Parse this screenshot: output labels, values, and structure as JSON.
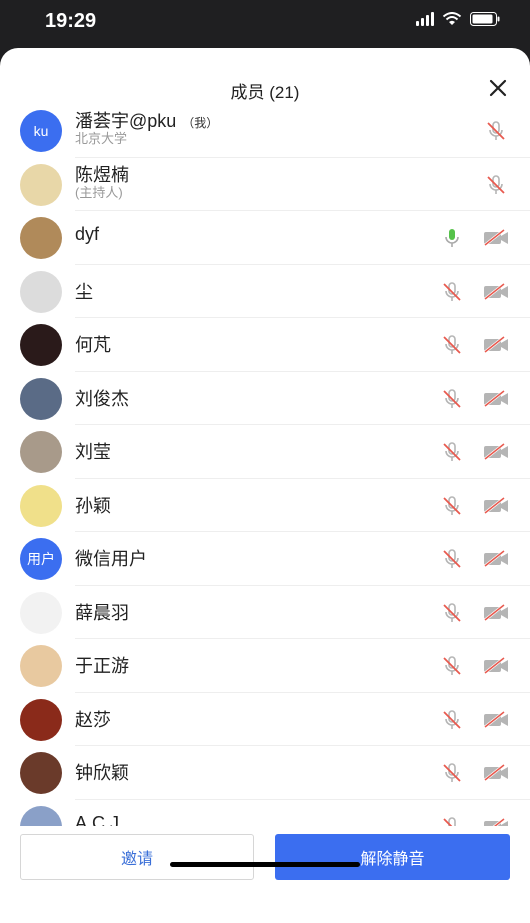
{
  "status": {
    "time": "19:29"
  },
  "header": {
    "title": "成员 (21)"
  },
  "members": [
    {
      "name": "潘荟宇@pku",
      "tag": "（我）",
      "sub": "北京大学",
      "avatar_text": "ku",
      "avatar_color": "#3b6ef0",
      "mic": "muted",
      "cam": null
    },
    {
      "name": "陈煜楠",
      "tag": "",
      "sub": "(主持人)",
      "avatar_text": "",
      "avatar_color": "#e8d7a8",
      "mic": "muted",
      "cam": null
    },
    {
      "name": "dyf",
      "tag": "",
      "sub": "",
      "avatar_text": "",
      "avatar_color": "#b08a5a",
      "mic": "on",
      "cam": "off"
    },
    {
      "name": "尘",
      "tag": "",
      "sub": "",
      "avatar_text": "",
      "avatar_color": "#dcdcdc",
      "mic": "muted",
      "cam": "off"
    },
    {
      "name": "何芃",
      "tag": "",
      "sub": "",
      "avatar_text": "",
      "avatar_color": "#2a1a1a",
      "mic": "muted",
      "cam": "off"
    },
    {
      "name": "刘俊杰",
      "tag": "",
      "sub": "",
      "avatar_text": "",
      "avatar_color": "#5a6b86",
      "mic": "muted",
      "cam": "off"
    },
    {
      "name": "刘莹",
      "tag": "",
      "sub": "",
      "avatar_text": "",
      "avatar_color": "#a89a8a",
      "mic": "muted",
      "cam": "off"
    },
    {
      "name": "孙颖",
      "tag": "",
      "sub": "",
      "avatar_text": "",
      "avatar_color": "#f0e08a",
      "mic": "muted",
      "cam": "off"
    },
    {
      "name": "微信用户",
      "tag": "",
      "sub": "",
      "avatar_text": "用户",
      "avatar_color": "#3b6ef0",
      "mic": "muted",
      "cam": "off"
    },
    {
      "name": "薛晨羽",
      "tag": "",
      "sub": "",
      "avatar_text": "",
      "avatar_color": "#f2f2f2",
      "mic": "muted",
      "cam": "off"
    },
    {
      "name": "于正游",
      "tag": "",
      "sub": "",
      "avatar_text": "",
      "avatar_color": "#e8c9a0",
      "mic": "muted",
      "cam": "off"
    },
    {
      "name": "赵莎",
      "tag": "",
      "sub": "",
      "avatar_text": "",
      "avatar_color": "#8a2a1a",
      "mic": "muted",
      "cam": "off"
    },
    {
      "name": "钟欣颖",
      "tag": "",
      "sub": "",
      "avatar_text": "",
      "avatar_color": "#6a3a2a",
      "mic": "muted",
      "cam": "off"
    },
    {
      "name": "A.C.J",
      "tag": "",
      "sub": "",
      "avatar_text": "",
      "avatar_color": "#8aa0c8",
      "mic": "muted",
      "cam": "off"
    }
  ],
  "footer": {
    "invite_label": "邀请",
    "unmute_label": "解除静音"
  },
  "colors": {
    "accent": "#3b6ef0",
    "muted_red": "#e85a4f",
    "mic_on": "#55c24a",
    "icon_gray": "#b5b5b5"
  }
}
